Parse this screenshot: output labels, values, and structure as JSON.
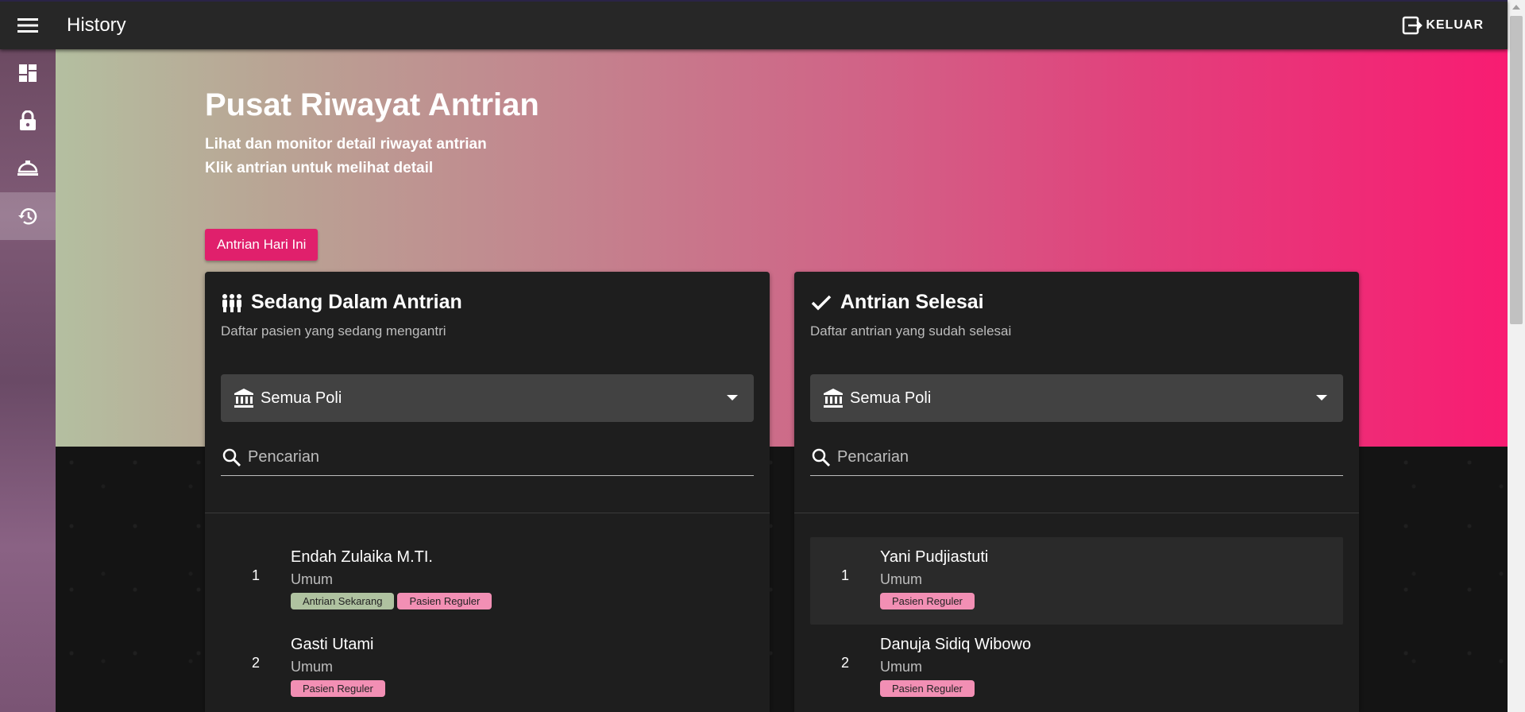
{
  "appbar": {
    "title": "History",
    "logout_label": "KELUAR"
  },
  "sidebar": {
    "items": [
      {
        "icon": "dashboard-icon"
      },
      {
        "icon": "lock-icon"
      },
      {
        "icon": "service-bell-icon"
      },
      {
        "icon": "history-icon",
        "active": true
      }
    ]
  },
  "hero": {
    "title": "Pusat Riwayat Antrian",
    "line1": "Lihat dan monitor detail riwayat antrian",
    "line2": "Klik antrian untuk melihat detail",
    "today_button": "Antrian Hari Ini"
  },
  "left_card": {
    "title": "Sedang Dalam Antrian",
    "subtitle": "Daftar pasien yang sedang mengantri",
    "select_value": "Semua Poli",
    "search_placeholder": "Pencarian",
    "items": [
      {
        "num": "1",
        "name": "Endah Zulaika M.TI.",
        "dept": "Umum",
        "badge1": "Antrian Sekarang",
        "badge2": "Pasien Reguler"
      },
      {
        "num": "2",
        "name": "Gasti Utami",
        "dept": "Umum",
        "badge1": "Pasien Reguler"
      }
    ]
  },
  "right_card": {
    "title": "Antrian Selesai",
    "subtitle": "Daftar antrian yang sudah selesai",
    "select_value": "Semua Poli",
    "search_placeholder": "Pencarian",
    "items": [
      {
        "num": "1",
        "name": "Yani Pudjiastuti",
        "dept": "Umum",
        "badge1": "Pasien Reguler"
      },
      {
        "num": "2",
        "name": "Danuja Sidiq Wibowo",
        "dept": "Umum",
        "badge1": "Pasien Reguler"
      }
    ]
  },
  "colors": {
    "accent": "#e0206c",
    "badge_green": "#afc2a0",
    "badge_pink": "#f28fb4",
    "card_bg": "#1e1e1e"
  }
}
